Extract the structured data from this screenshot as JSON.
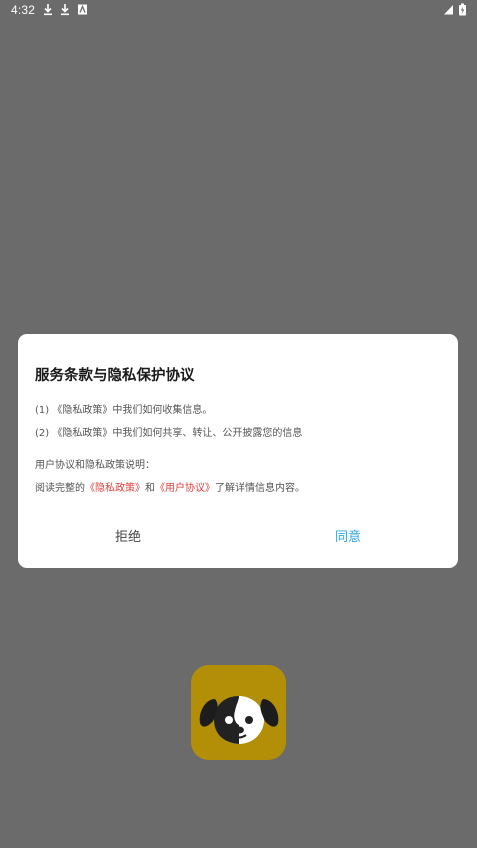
{
  "status_bar": {
    "time": "4:32",
    "left_icons": [
      "download-icon",
      "download-icon",
      "accessibility-icon"
    ],
    "right_icons": [
      "signal-icon",
      "battery-icon"
    ]
  },
  "dialog": {
    "title": "服务条款与隐私保护协议",
    "line1": "(1) 《隐私政策》中我们如何收集信息。",
    "line2": "(2) 《隐私政策》中我们如何共享、转让、公开披露您的信息",
    "line3": "用户协议和隐私政策说明：",
    "line4": {
      "prefix": "阅读完整的",
      "privacy_link": "《隐私政策》",
      "conjunction": "和",
      "user_link": "《用户协议》",
      "suffix": "了解详情信息内容。"
    },
    "reject_label": "拒绝",
    "agree_label": "同意"
  },
  "app": {
    "icon": "dog-face-icon"
  },
  "colors": {
    "overlay": "#6b6b6b",
    "link": "#e0403a",
    "agree": "#2aa7e6",
    "icon_bg": "#b38f08"
  }
}
